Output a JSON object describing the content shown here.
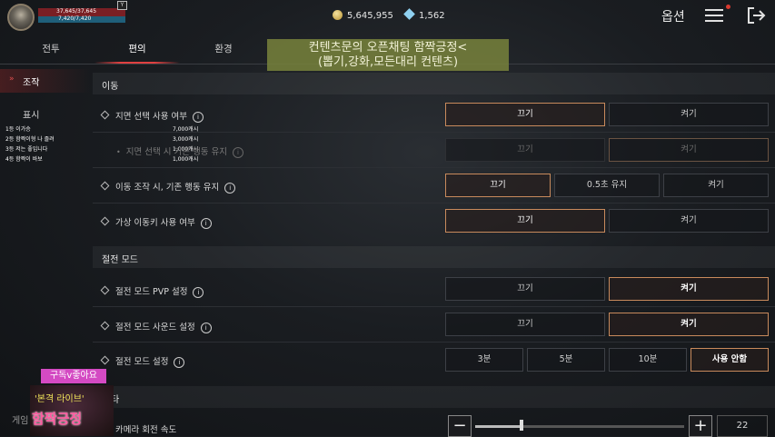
{
  "hud": {
    "hp": "37,645/37,645",
    "mp": "7,420/7,420",
    "level_badge": "Y",
    "gold": "5,645,955",
    "gems": "1,562",
    "title": "옵션"
  },
  "tabs": [
    {
      "label": "전투"
    },
    {
      "label": "편의"
    },
    {
      "label": "환경"
    }
  ],
  "overlay": {
    "line1": "컨텐츠문의 오픈채팅 함짝긍정<",
    "line2": "(뽑기,강화,모든대리 컨텐츠)"
  },
  "sidebar": {
    "items": [
      {
        "label": "조작"
      },
      {
        "label": "표시"
      },
      {
        "label": "게임"
      }
    ],
    "ranking": [
      {
        "rank": "1등",
        "name": "이가승",
        "amount": "7,000캐시"
      },
      {
        "rank": "2등",
        "name": "함짝이형 나 졸려",
        "amount": "3,000캐시"
      },
      {
        "rank": "3등",
        "name": "저는 좋입니다",
        "amount": "1,000캐시"
      },
      {
        "rank": "4등",
        "name": "함짝이 바보",
        "amount": "1,000캐시"
      }
    ]
  },
  "sections": {
    "move": "이동",
    "power_save": "절전 모드",
    "other_partial": "타"
  },
  "rows": {
    "target_select": {
      "label": "지면 선택 사용 여부",
      "options": [
        "끄기",
        "켜기"
      ],
      "selected": "끄기"
    },
    "target_keep": {
      "label": "지면 선택 시 기존 행동 유지",
      "options": [
        "끄기",
        "켜기"
      ],
      "selected": "켜기",
      "disabled": true
    },
    "move_keep": {
      "label": "이동 조작 시, 기존 행동 유지",
      "options": [
        "끄기",
        "0.5초 유지",
        "켜기"
      ],
      "selected": "끄기"
    },
    "virtual_key": {
      "label": "가상 이동키 사용 여부",
      "options": [
        "끄기",
        "켜기"
      ],
      "selected": "끄기"
    },
    "pvp": {
      "label": "절전 모드 PVP 설정",
      "options": [
        "끄기",
        "켜기"
      ],
      "selected": "켜기"
    },
    "sound": {
      "label": "절전 모드 사운드 설정",
      "options": [
        "끄기",
        "켜기"
      ],
      "selected": "켜기"
    },
    "mode": {
      "label": "절전 모드 설정",
      "options": [
        "3분",
        "5분",
        "10분",
        "사용 안함"
      ],
      "selected": "사용 안함"
    },
    "camera": {
      "label": "카메라 회전 속도",
      "value": "22",
      "fraction": 0.22
    }
  },
  "stickers": {
    "sub": "구독v좋아요",
    "live": "'본격 라이브'",
    "brand": "함짝긍정"
  },
  "colors": {
    "accent_selected": "#c88a5c",
    "tab_underline": "#e04040",
    "hp": "#7a1f24",
    "mp": "#1f5f7a"
  }
}
